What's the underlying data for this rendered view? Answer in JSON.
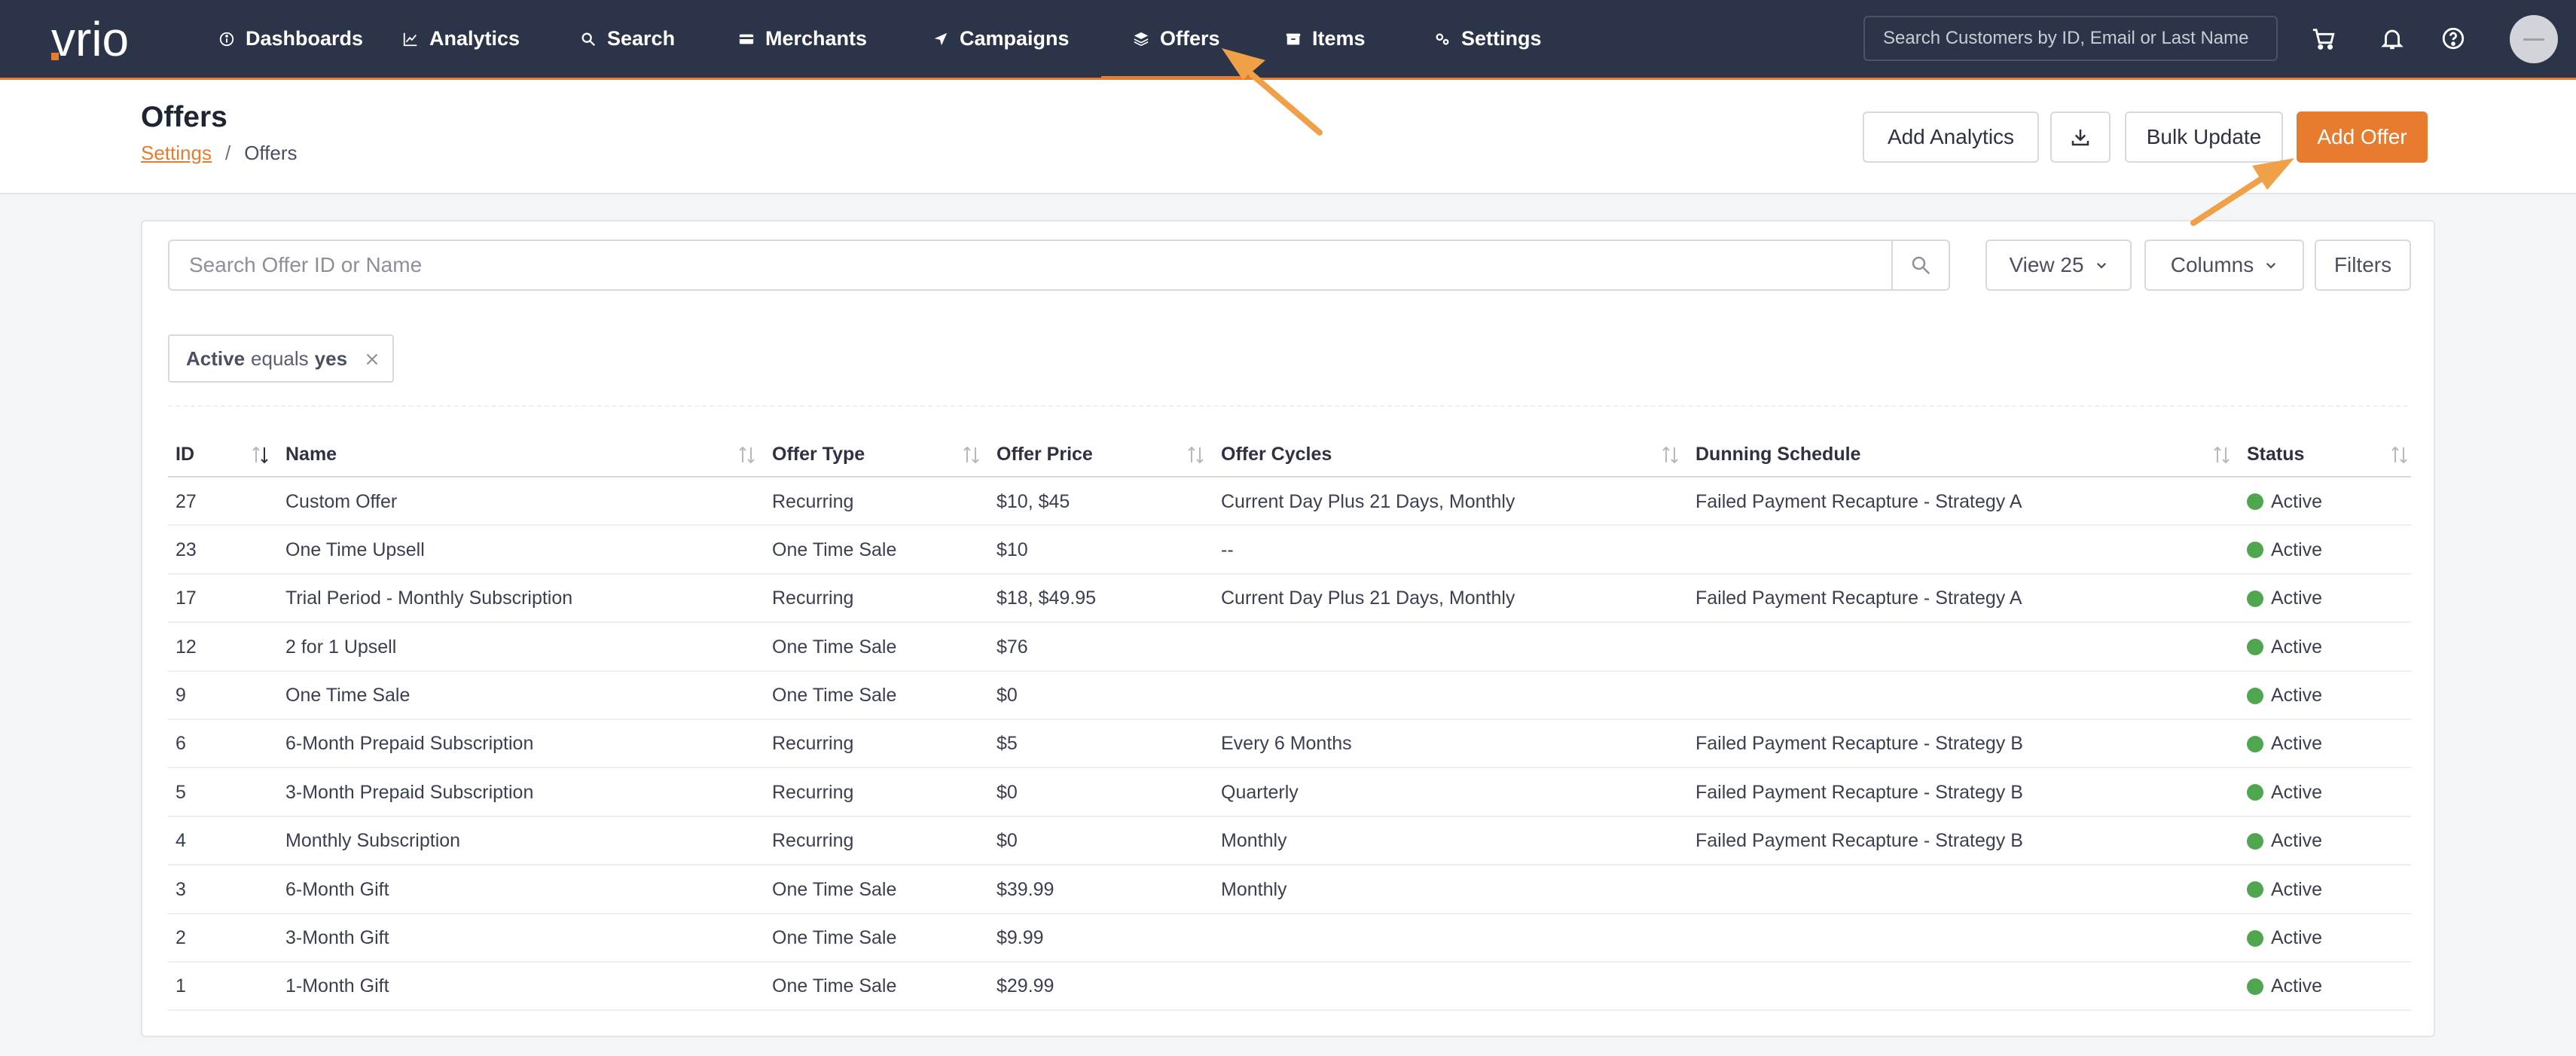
{
  "brand": {
    "logo_text": "vrio",
    "accent": "#e77b2e",
    "nav_bg": "#2b3448"
  },
  "nav": {
    "items": [
      {
        "label": "Dashboards",
        "icon": "info-circle-icon"
      },
      {
        "label": "Analytics",
        "icon": "line-chart-icon"
      },
      {
        "label": "Search",
        "icon": "search-icon"
      },
      {
        "label": "Merchants",
        "icon": "credit-card-icon"
      },
      {
        "label": "Campaigns",
        "icon": "paper-plane-icon"
      },
      {
        "label": "Offers",
        "icon": "layers-icon",
        "active": true
      },
      {
        "label": "Items",
        "icon": "box-icon"
      },
      {
        "label": "Settings",
        "icon": "gears-icon"
      }
    ],
    "search_placeholder": "Search Customers by ID, Email or Last Name",
    "icons": [
      "cart-icon",
      "bell-icon",
      "help-icon",
      "avatar"
    ]
  },
  "header": {
    "title": "Offers",
    "breadcrumb": {
      "parent": "Settings",
      "separator": "/",
      "current": "Offers"
    },
    "buttons": {
      "add_analytics": "Add Analytics",
      "bulk_update": "Bulk Update",
      "add_offer": "Add Offer"
    }
  },
  "toolbar": {
    "search_placeholder": "Search Offer ID or Name",
    "view": "View 25",
    "columns": "Columns",
    "filters": "Filters"
  },
  "filter_chip": {
    "field": "Active",
    "operator": "equals",
    "value": "yes"
  },
  "table": {
    "columns": [
      "ID",
      "Name",
      "Offer Type",
      "Offer Price",
      "Offer Cycles",
      "Dunning Schedule",
      "Status"
    ],
    "rows": [
      [
        "27",
        "Custom Offer",
        "Recurring",
        "$10, $45",
        "Current Day Plus 21 Days, Monthly",
        "Failed Payment Recapture - Strategy A",
        "Active"
      ],
      [
        "23",
        "One Time Upsell",
        "One Time Sale",
        "$10",
        "--",
        "",
        "Active"
      ],
      [
        "17",
        "Trial Period - Monthly Subscription",
        "Recurring",
        "$18, $49.95",
        "Current Day Plus 21 Days, Monthly",
        "Failed Payment Recapture - Strategy A",
        "Active"
      ],
      [
        "12",
        "2 for 1 Upsell",
        "One Time Sale",
        "$76",
        "",
        "",
        "Active"
      ],
      [
        "9",
        "One Time Sale",
        "One Time Sale",
        "$0",
        "",
        "",
        "Active"
      ],
      [
        "6",
        "6-Month Prepaid Subscription",
        "Recurring",
        "$5",
        "Every 6 Months",
        "Failed Payment Recapture - Strategy B",
        "Active"
      ],
      [
        "5",
        "3-Month Prepaid Subscription",
        "Recurring",
        "$0",
        "Quarterly",
        "Failed Payment Recapture - Strategy B",
        "Active"
      ],
      [
        "4",
        "Monthly Subscription",
        "Recurring",
        "$0",
        "Monthly",
        "Failed Payment Recapture - Strategy B",
        "Active"
      ],
      [
        "3",
        "6-Month Gift",
        "One Time Sale",
        "$39.99",
        "Monthly",
        "",
        "Active"
      ],
      [
        "2",
        "3-Month Gift",
        "One Time Sale",
        "$9.99",
        "",
        "",
        "Active"
      ],
      [
        "1",
        "1-Month Gift",
        "One Time Sale",
        "$29.99",
        "",
        "",
        "Active"
      ]
    ],
    "status_color": "#4fa64f"
  }
}
